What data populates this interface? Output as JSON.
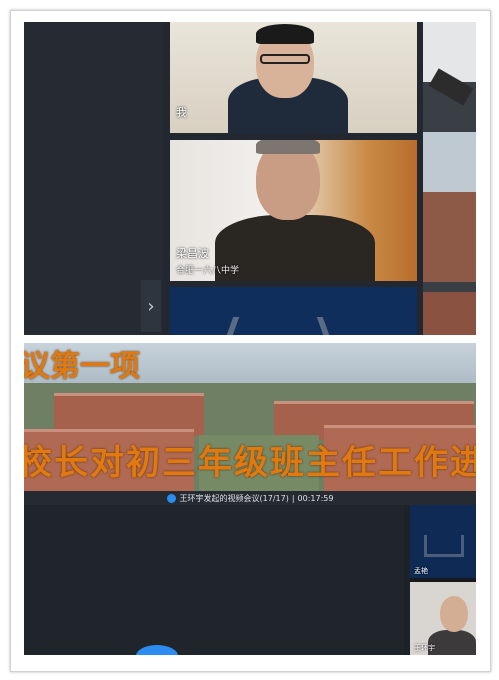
{
  "top": {
    "tiles": [
      {
        "name": "我",
        "subtitle": ""
      },
      {
        "name": "梁昌波",
        "subtitle": "合肥一六八中学"
      }
    ],
    "chevron": "›"
  },
  "bottom": {
    "banner_line1": "议第一项",
    "banner_line2": "校长对初三年级班主任工作进行",
    "meeting_bar": {
      "title": "王环宇发起的视频会议(17/17)",
      "separator": "|",
      "timer": "00:17:59"
    },
    "side_tiles": [
      {
        "name": "孟艳"
      },
      {
        "name": "王环宇"
      }
    ]
  },
  "colors": {
    "meeting_accent": "#2d8cf0",
    "banner_text": "#e07a10"
  }
}
